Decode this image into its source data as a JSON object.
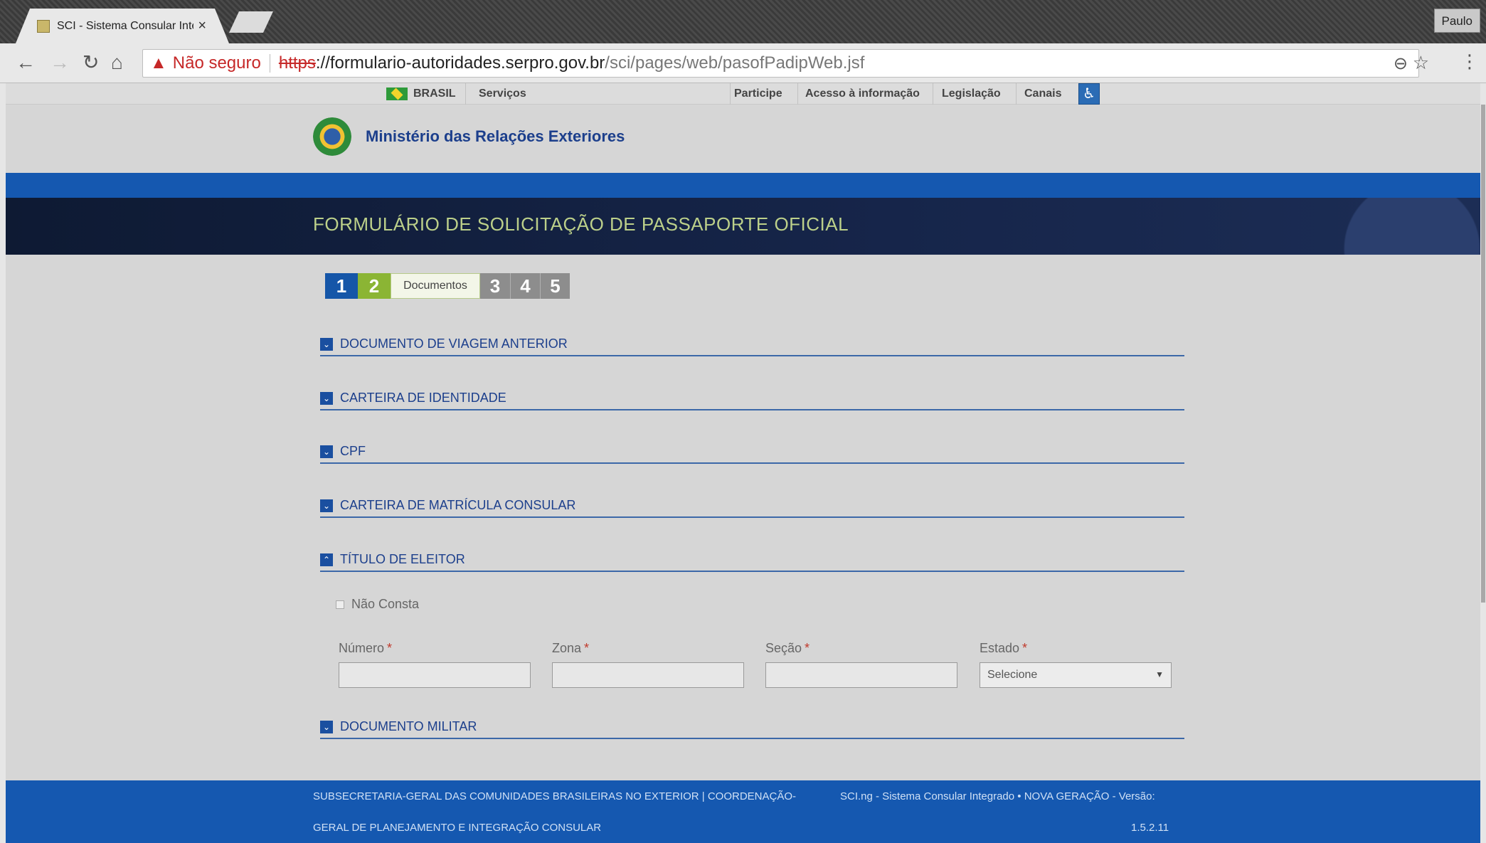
{
  "browser": {
    "tab_title": "SCI - Sistema Consular Inte",
    "profile": "Paulo",
    "not_secure": "Não seguro",
    "url_scheme": "https",
    "url_rest": "://",
    "url_host": "formulario-autoridades.serpro.gov.br",
    "url_path": "/sci/pages/web/pasofPadipWeb.jsf"
  },
  "govbar": {
    "country": "BRASIL",
    "services": "Serviços",
    "participe": "Participe",
    "acesso": "Acesso à informação",
    "legislacao": "Legislação",
    "canais": "Canais"
  },
  "ministry": {
    "name": "Ministério das Relações Exteriores"
  },
  "form": {
    "title": "FORMULÁRIO DE SOLICITAÇÃO DE PASSAPORTE OFICIAL",
    "steps": [
      "1",
      "2",
      "Documentos",
      "3",
      "4",
      "5"
    ],
    "sections": [
      "DOCUMENTO DE VIAGEM ANTERIOR",
      "CARTEIRA DE IDENTIDADE",
      "CPF",
      "CARTEIRA DE MATRÍCULA CONSULAR",
      "TÍTULO DE ELEITOR",
      "DOCUMENTO MILITAR"
    ],
    "nao_consta": "Não Consta",
    "fields": {
      "numero": "Número",
      "zona": "Zona",
      "secao": "Seção",
      "estado": "Estado",
      "required_mark": "*",
      "estado_value": "Selecione"
    }
  },
  "footer": {
    "left_line1": "SUBSECRETARIA-GERAL DAS COMUNIDADES BRASILEIRAS NO EXTERIOR | COORDENAÇÃO-",
    "left_line2": "GERAL DE PLANEJAMENTO E INTEGRAÇÃO CONSULAR",
    "right_line1": "SCI.ng - Sistema Consular Integrado • NOVA GERAÇÃO - Versão:",
    "right_line2": "1.5.2.11"
  }
}
